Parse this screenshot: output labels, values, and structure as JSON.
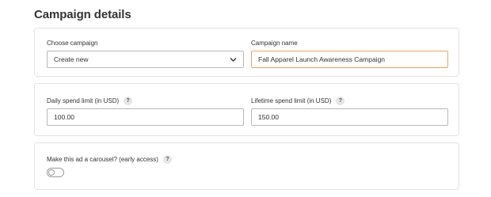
{
  "section": {
    "title": "Campaign details"
  },
  "campaign": {
    "choose_label": "Choose campaign",
    "choose_value": "Create new",
    "name_label": "Campaign name",
    "name_value": "Fall Apparel Launch Awareness Campaign"
  },
  "spend": {
    "daily_label": "Daily spend limit (in USD)",
    "daily_help": "?",
    "daily_value": "100.00",
    "lifetime_label": "Lifetime spend limit (in USD)",
    "lifetime_help": "?",
    "lifetime_value": "150.00"
  },
  "carousel": {
    "label": "Make this ad a carousel? (early access)",
    "help": "?",
    "enabled": false
  },
  "colors": {
    "focus_border": "#f5a262",
    "card_border": "#e3e3e3",
    "input_border": "#b9b9b9"
  },
  "icons": {
    "select_chevron": "chevron-down-icon",
    "help": "question-mark-icon"
  }
}
